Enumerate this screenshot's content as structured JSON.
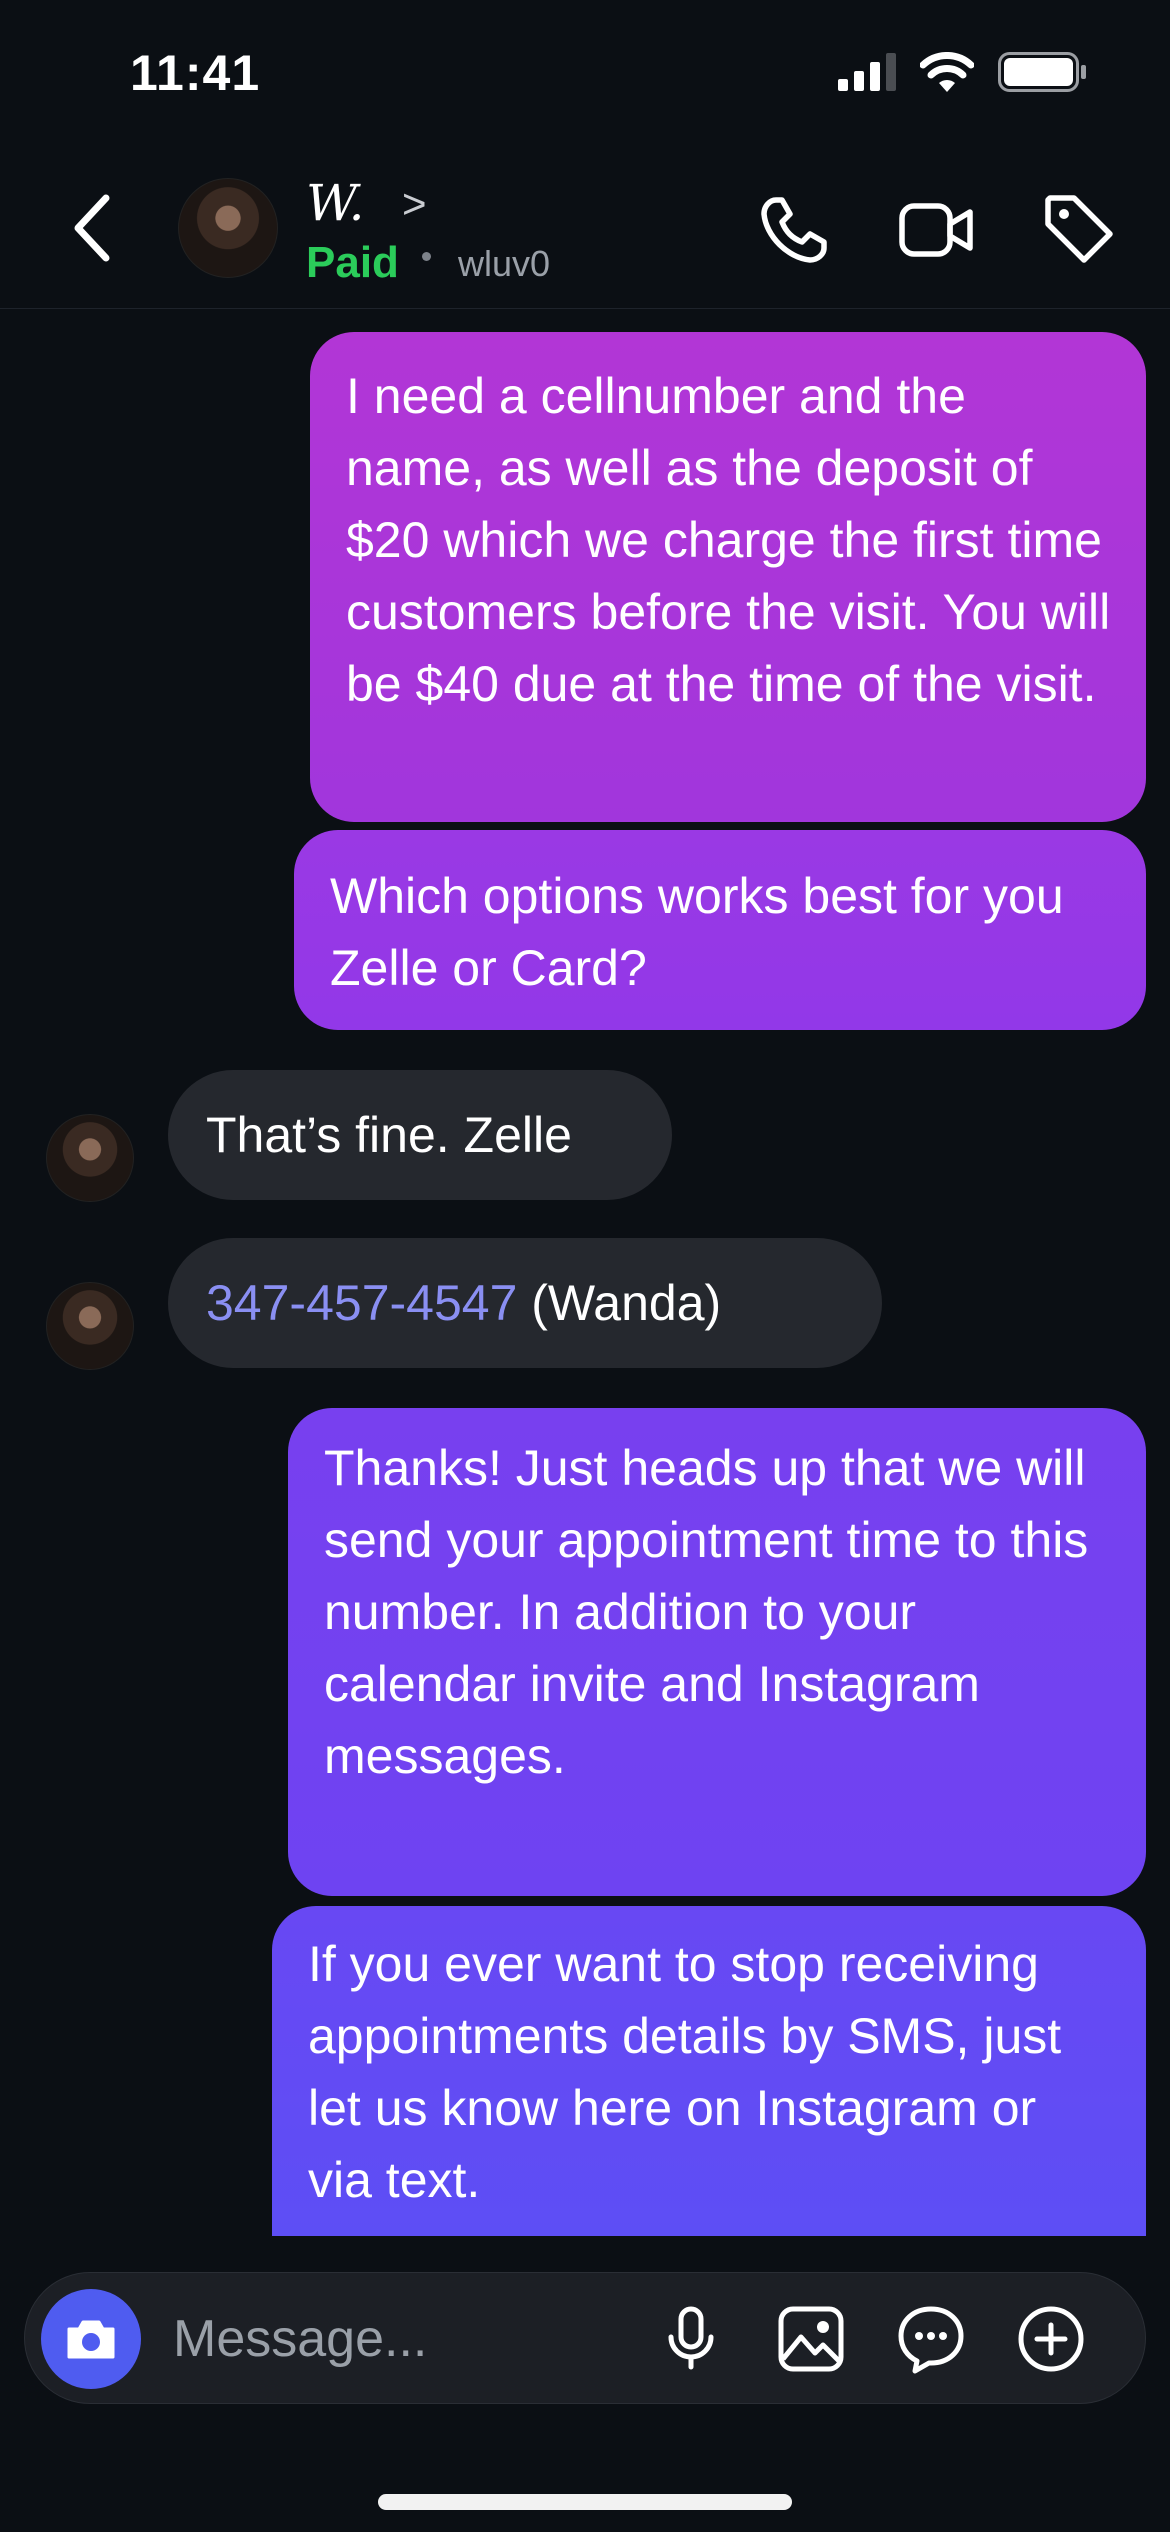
{
  "status_bar": {
    "time": "11:41",
    "icons": [
      "cellular-signal-icon",
      "wifi-icon",
      "battery-icon"
    ]
  },
  "header": {
    "contact_name": "W.",
    "chevron": ">",
    "status_label": "Paid",
    "username": "wluv0",
    "icons": [
      "back-icon",
      "phone-icon",
      "video-icon",
      "tag-icon"
    ]
  },
  "messages": [
    {
      "direction": "outgoing",
      "text": "I need a cellnumber and the name, as well as the deposit of $20 which we charge the first time customers before the visit. You will be $40 due at the time of the visit."
    },
    {
      "direction": "outgoing",
      "text": "Which options works best for you Zelle or Card?"
    },
    {
      "direction": "incoming",
      "text": "That’s fine. Zelle"
    },
    {
      "direction": "incoming",
      "phone": "347-457-4547",
      "text": " (Wanda)"
    },
    {
      "direction": "outgoing",
      "text": "Thanks! Just heads up that we will send your appointment time to this number. In addition to your calendar invite and Instagram messages."
    },
    {
      "direction": "outgoing",
      "text": "If you ever want to stop receiving appointments details by SMS, just let us know here on Instagram or via text."
    }
  ],
  "composer": {
    "placeholder": "Message...",
    "icons": [
      "camera-icon",
      "microphone-icon",
      "gallery-icon",
      "sticker-icon",
      "plus-icon"
    ]
  },
  "colors": {
    "background": "#0b0f14",
    "paid_green": "#2bcc5a",
    "incoming_bubble": "#25282e",
    "outgoing_gradient_top": "#b236d6",
    "outgoing_gradient_bottom": "#5d4ef5",
    "link": "#8a8ff2",
    "camera_button": "#4f5cf0"
  }
}
